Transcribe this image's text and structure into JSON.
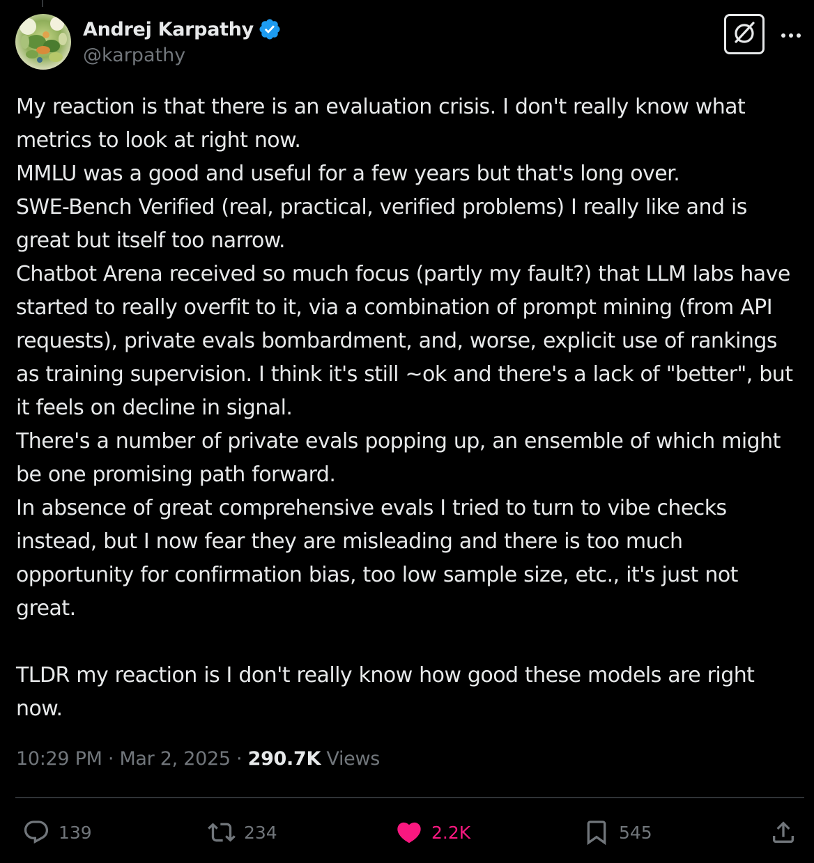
{
  "author": {
    "display_name": "Andrej Karpathy",
    "handle": "@karpathy",
    "verified": true
  },
  "tweet": {
    "lines": [
      "My reaction is that there is an evaluation crisis. I don't really know what",
      "metrics to look at right now.",
      "MMLU was a good and useful for a few years but that's long over.",
      "SWE-Bench Verified (real, practical, verified problems) I really like and is",
      "great but itself too narrow.",
      "Chatbot Arena received so much focus (partly my fault?) that LLM labs have",
      "started to really overfit to it, via a combination of prompt mining (from API",
      "requests), private evals bombardment, and, worse, explicit use of rankings",
      "as training supervision. I think it's still ~ok and there's a lack of \"better\", but",
      "it feels on decline in signal.",
      "There's a number of private evals popping up, an ensemble of which might",
      "be one promising path forward.",
      "In absence of great comprehensive evals I tried to turn to vibe checks",
      "instead, but I now fear they are misleading and there is too much",
      "opportunity for confirmation bias, too low sample size, etc., it's just not",
      "great.",
      "",
      "TLDR my reaction is I don't really know how good these models are right",
      "now."
    ]
  },
  "meta": {
    "time": "10:29 PM",
    "separator": " · ",
    "date": "Mar 2, 2025",
    "views_count": "290.7K",
    "views_label": " Views"
  },
  "actions": {
    "replies": "139",
    "reposts": "234",
    "likes": "2.2K",
    "bookmarks": "545"
  },
  "colors": {
    "background": "#000000",
    "text": "#e7e9ea",
    "muted": "#71767b",
    "like": "#f91880",
    "verified": "#1d9bf0",
    "divider": "#2f3336"
  },
  "icons": {
    "reply": "speech-bubble-icon",
    "repost": "repost-arrows-icon",
    "like": "heart-filled-icon",
    "bookmark": "bookmark-icon",
    "share": "share-upload-icon",
    "grok": "grok-icon",
    "more": "more-horizontal-icon",
    "verified": "verified-badge-icon"
  }
}
